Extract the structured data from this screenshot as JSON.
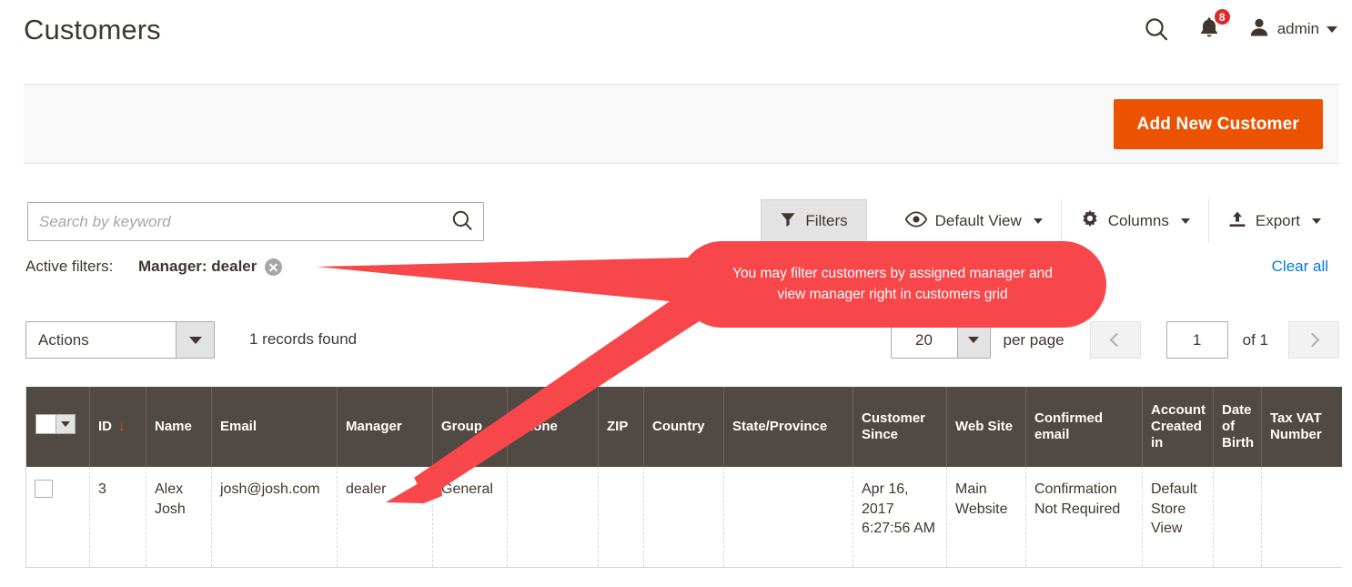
{
  "header": {
    "title": "Customers",
    "search_icon": "search-icon",
    "notifications": {
      "icon": "bell-icon",
      "count": "8"
    },
    "user": {
      "icon": "user-avatar-icon",
      "name": "admin",
      "caret": "chevron-down-icon"
    }
  },
  "page_actions": {
    "add_new_customer": "Add New Customer"
  },
  "toolbar": {
    "search": {
      "placeholder": "Search by keyword",
      "value": "",
      "icon": "search-icon"
    },
    "filters": {
      "label": "Filters",
      "icon": "funnel-icon"
    },
    "view": {
      "label": "Default View",
      "icon": "eye-icon",
      "caret": "chevron-down-icon"
    },
    "columns": {
      "label": "Columns",
      "icon": "gear-icon",
      "caret": "chevron-down-icon"
    },
    "export": {
      "label": "Export",
      "icon": "upload-icon",
      "caret": "chevron-down-icon"
    }
  },
  "active_filters": {
    "label": "Active filters:",
    "chips": [
      {
        "text": "Manager: dealer",
        "remove_icon": "close-circle-icon"
      }
    ],
    "clear_all": "Clear all"
  },
  "grid_controls": {
    "actions": {
      "label": "Actions",
      "caret": "chevron-down-icon"
    },
    "records_found": "1 records found",
    "per_page": {
      "value": "20",
      "label": "per page",
      "caret": "chevron-down-icon"
    },
    "prev_icon": "chevron-left-icon",
    "next_icon": "chevron-right-icon",
    "page_value": "1",
    "page_of": "of 1"
  },
  "grid": {
    "select_all": {
      "checkbox": "select-all-checkbox",
      "caret": "chevron-down-icon"
    },
    "columns": [
      {
        "label": "ID",
        "sort": "↓"
      },
      {
        "label": "Name"
      },
      {
        "label": "Email"
      },
      {
        "label": "Manager"
      },
      {
        "label": "Group"
      },
      {
        "label": "Phone"
      },
      {
        "label": "ZIP"
      },
      {
        "label": "Country"
      },
      {
        "label": "State/Province"
      },
      {
        "label": "Customer Since"
      },
      {
        "label": "Web Site"
      },
      {
        "label": "Confirmed email"
      },
      {
        "label": "Account Created in"
      },
      {
        "label": "Date of Birth"
      },
      {
        "label": "Tax VAT Number"
      }
    ],
    "rows": [
      {
        "id": "3",
        "name": "Alex Josh",
        "email": "josh@josh.com",
        "manager": "dealer",
        "group": "General",
        "phone": "",
        "zip": "",
        "country": "",
        "state_province": "",
        "customer_since": "Apr 16, 2017 6:27:56 AM",
        "web_site": "Main Website",
        "confirmed_email": "Confirmation Not Required",
        "account_created_in": "Default Store View",
        "date_of_birth": "",
        "tax_vat_number": ""
      }
    ]
  },
  "annotation": {
    "callout_text": "You may filter customers by assigned manager and view manager right in customers grid",
    "arrow_color": "#f7474a"
  },
  "colors": {
    "accent_orange": "#eb5202",
    "link_blue": "#007bdb",
    "header_dark": "#514943",
    "badge_red": "#e22626",
    "annotation_red": "#f7474a"
  }
}
